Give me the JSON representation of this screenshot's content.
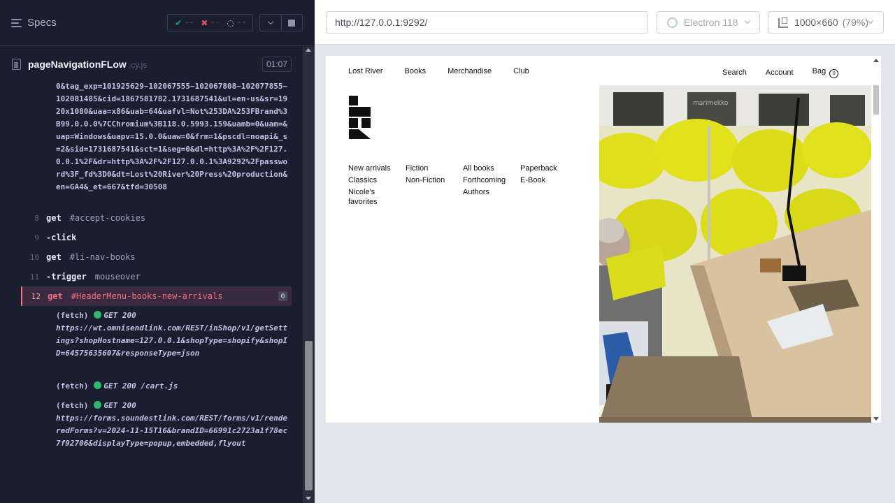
{
  "reporter": {
    "specs_label": "Specs",
    "stats": {
      "passed": "--",
      "failed": "--",
      "pending": "--"
    },
    "spec": {
      "name": "pageNavigationFLow",
      "ext": ".cy.js",
      "duration": "01:07"
    },
    "url_fragment": "0&tag_exp=101925629~102067555~102067808~102077855~102081485&cid=1867581782.1731687541&ul=en-us&sr=1920x1080&uaa=x86&uab=64&uafvl=Not%253DA%253FBrand%3B99.0.0.0%7CChromium%3B118.0.5993.159&uamb=0&uam=&uap=Windows&uapv=15.0.0&uaw=0&frm=1&pscdl=noapi&_s=2&sid=1731687541&sct=1&seg=0&dl=http%3A%2F%2F127.0.0.1%2F&dr=http%3A%2F%2F127.0.0.1%3A9292%2Fpassword%3F_fd%3D0&dt=Lost%20River%20Press%20production&en=GA4&_et=667&tfd=30508",
    "commands": [
      {
        "num": "8",
        "name": "get",
        "msg": "#accept-cookies"
      },
      {
        "num": "9",
        "name": "-click",
        "msg": ""
      },
      {
        "num": "10",
        "name": "get",
        "msg": "#li-nav-books"
      },
      {
        "num": "11",
        "name": "-trigger",
        "msg": "mouseover"
      },
      {
        "num": "12",
        "name": "get",
        "msg": "#HeaderMenu-books-new-arrivals",
        "badge": "0"
      }
    ],
    "fetches": [
      {
        "label": "(fetch)",
        "status": "GET 200",
        "url": "https://wt.omnisendlink.com/REST/inShop/v1/getSettings?shopHostname=127.0.0.1&shopType=shopify&shopID=64575635607&responseType=json"
      },
      {
        "label": "(fetch)",
        "status": "GET 200",
        "url": "/cart.js"
      },
      {
        "label": "(fetch)",
        "status": "GET 200",
        "url": "https://forms.soundestlink.com/REST/forms/v1/renderedForms?v=2024-11-15T16&brandID=66991c2723a1f78ec7f92706&displayType=popup,embedded,flyout"
      }
    ]
  },
  "aut": {
    "url": "http://127.0.0.1:9292/",
    "browser": "Electron 118",
    "viewport": "1000x660",
    "viewport_scale": "(79%)"
  },
  "site": {
    "nav_left": [
      "Lost River",
      "Books",
      "Merchandise",
      "Club"
    ],
    "nav_right": {
      "search": "Search",
      "account": "Account",
      "bag": "Bag",
      "bag_count": "0"
    },
    "menu": {
      "col1": [
        "New arrivals",
        "Classics",
        "Nicole's favorites"
      ],
      "col2": [
        "Fiction",
        "Non-Fiction"
      ],
      "col3": [
        "All books",
        "Forthcoming",
        "Authors"
      ],
      "col4": [
        "Paperback",
        "E-Book"
      ]
    },
    "photo_sign": "marimekko"
  },
  "colors": {
    "accent_error": "#f26e83",
    "success_dot": "#2fb86e",
    "panel_bg": "#1b1e2e"
  }
}
